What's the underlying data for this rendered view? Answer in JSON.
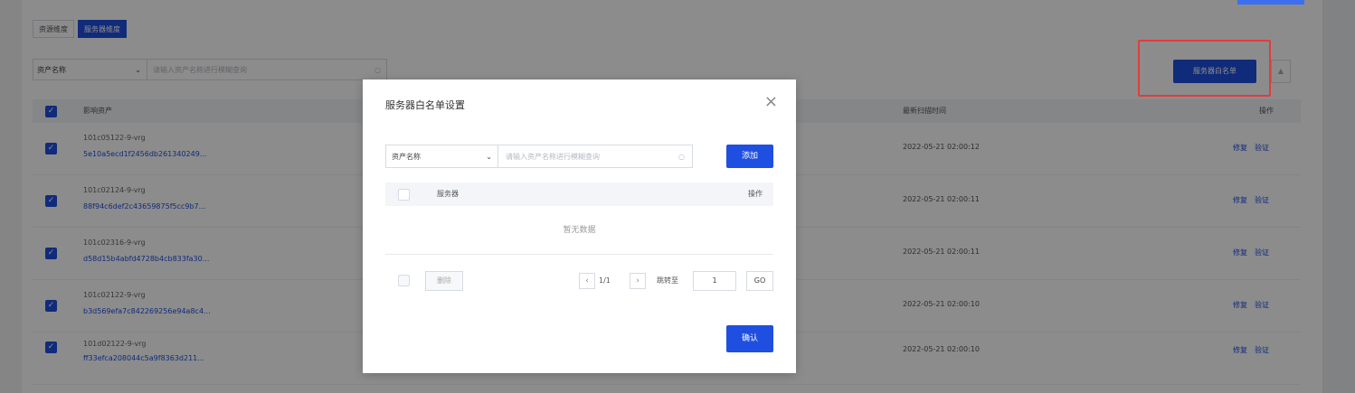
{
  "tabs": [
    {
      "label": "资源维度",
      "active": false
    },
    {
      "label": "服务器维度",
      "active": true
    }
  ],
  "filter": {
    "select_value": "资产名称",
    "placeholder": "请输入资产名称进行模糊查询"
  },
  "toolbar": {
    "whitelist_label": "服务器白名单",
    "collapse_icon": "▲"
  },
  "table": {
    "headers": {
      "asset": "影响资产",
      "scan_time": "最新扫描时间",
      "action": "操作"
    },
    "rows": [
      {
        "name": "101c05122-9-vrg",
        "id": "5e10a5ecd1f2456db261340249...",
        "time": "2022-05-21 02:00:12",
        "fix": "修复",
        "verify": "验证"
      },
      {
        "name": "101c02124-9-vrg",
        "id": "88f94c6def2c43659875f5cc9b7...",
        "time": "2022-05-21 02:00:11",
        "fix": "修复",
        "verify": "验证"
      },
      {
        "name": "101c02316-9-vrg",
        "id": "d58d15b4abfd4728b4cb833fa30...",
        "time": "2022-05-21 02:00:11",
        "fix": "修复",
        "verify": "验证"
      },
      {
        "name": "101c02122-9-vrg",
        "id": "b3d569efa7c842269256e94a8c4...",
        "time": "2022-05-21 02:00:10",
        "fix": "修复",
        "verify": "验证"
      },
      {
        "name": "101d02122-9-vrg",
        "id": "ff33efca208044c5a9f8363d211...",
        "time": "2022-05-21 02:00:10",
        "fix": "修复",
        "verify": "验证"
      }
    ]
  },
  "modal": {
    "title": "服务器白名单设置",
    "close_icon": "×",
    "select_value": "资产名称",
    "placeholder": "请输入资产名称进行模糊查询",
    "add_label": "添加",
    "col_server": "服务器",
    "col_action": "操作",
    "empty_text": "暂无数据",
    "delete_label": "删除",
    "page_info": "1/1",
    "jump_label": "跳转至",
    "jump_value": "1",
    "go_label": "GO",
    "confirm_label": "确认"
  },
  "colors": {
    "primary": "#1f4fe0",
    "highlight_border": "#e23c3c"
  }
}
